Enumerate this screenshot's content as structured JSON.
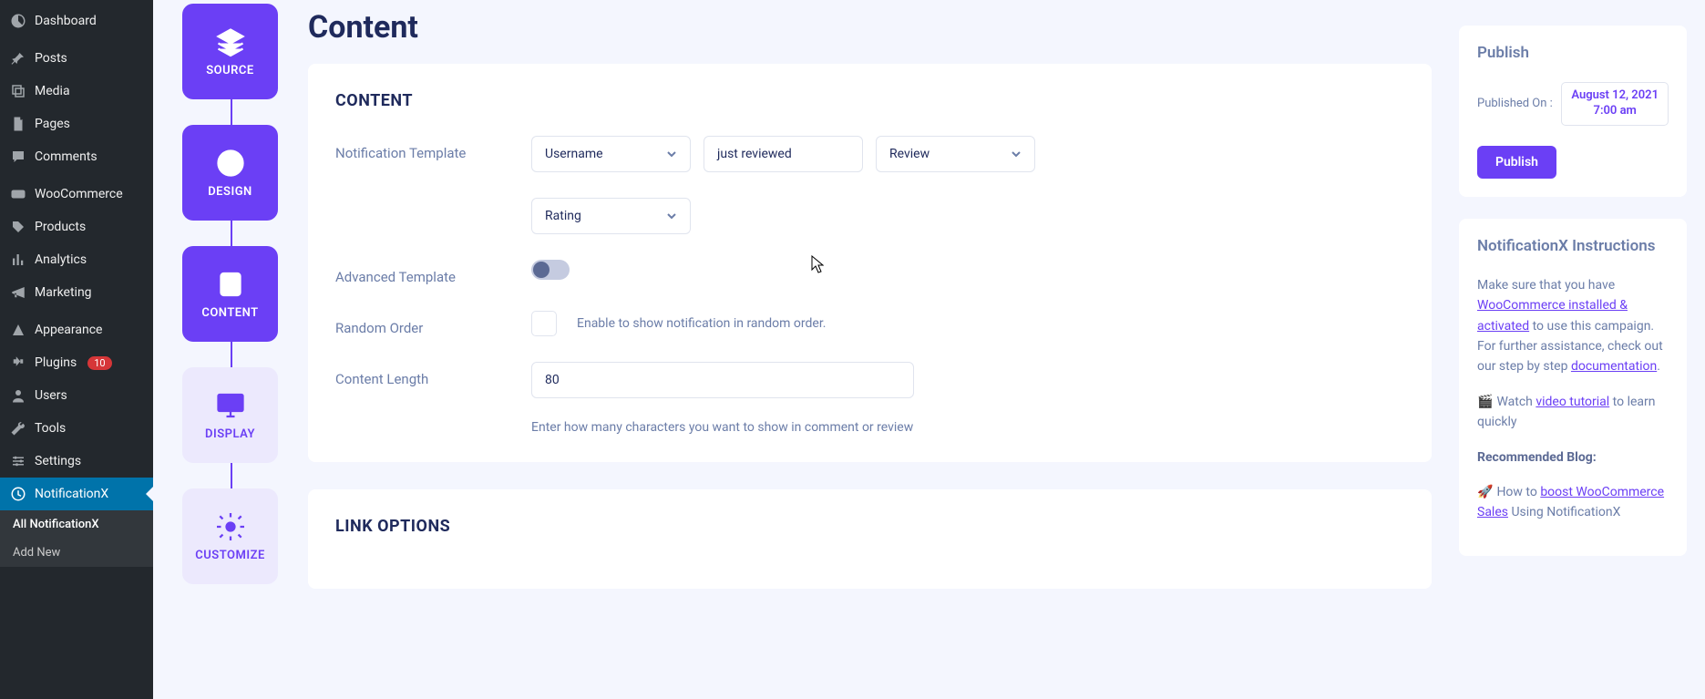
{
  "wp_sidebar": {
    "items": [
      {
        "label": "Dashboard",
        "icon": "dashboard"
      },
      {
        "label": "Posts",
        "icon": "pin"
      },
      {
        "label": "Media",
        "icon": "media"
      },
      {
        "label": "Pages",
        "icon": "pages"
      },
      {
        "label": "Comments",
        "icon": "comment"
      },
      {
        "label": "WooCommerce",
        "icon": "woo"
      },
      {
        "label": "Products",
        "icon": "products"
      },
      {
        "label": "Analytics",
        "icon": "analytics"
      },
      {
        "label": "Marketing",
        "icon": "marketing"
      },
      {
        "label": "Appearance",
        "icon": "appearance"
      },
      {
        "label": "Plugins",
        "icon": "plugins",
        "badge": "10"
      },
      {
        "label": "Users",
        "icon": "users"
      },
      {
        "label": "Tools",
        "icon": "tools"
      },
      {
        "label": "Settings",
        "icon": "settings"
      },
      {
        "label": "NotificationX",
        "icon": "notifx",
        "active": true
      }
    ],
    "subitems": [
      {
        "label": "All NotificationX",
        "current": true
      },
      {
        "label": "Add New"
      }
    ]
  },
  "steps": [
    {
      "label": "SOURCE",
      "icon": "layers"
    },
    {
      "label": "DESIGN",
      "icon": "palette"
    },
    {
      "label": "CONTENT",
      "icon": "doc"
    },
    {
      "label": "DISPLAY",
      "icon": "monitor"
    },
    {
      "label": "CUSTOMIZE",
      "icon": "gear"
    }
  ],
  "page": {
    "title": "Content"
  },
  "content_card": {
    "title": "CONTENT",
    "fields": {
      "template_label": "Notification Template",
      "dd_username": "Username",
      "txt_middle": "just reviewed",
      "dd_review": "Review",
      "dd_rating": "Rating",
      "adv_label": "Advanced Template",
      "random_label": "Random Order",
      "random_help": "Enable to show notification in random order.",
      "length_label": "Content Length",
      "length_value": "80",
      "length_hint": "Enter how many characters you want to show in comment or review"
    }
  },
  "link_card": {
    "title": "LINK OPTIONS"
  },
  "publish": {
    "title": "Publish",
    "on_label": "Published On :",
    "on_value_line1": "August 12, 2021",
    "on_value_line2": "7:00 am",
    "button": "Publish"
  },
  "instructions": {
    "title": "NotificationX Instructions",
    "p1_a": "Make sure that you have ",
    "p1_link": "WooCommerce installed & activated",
    "p1_b": " to use this campaign. For further assistance, check out our step by step ",
    "p1_doclink": "documentation",
    "p2_a": "Watch ",
    "p2_link": "video tutorial",
    "p2_b": " to learn quickly",
    "p3": "Recommended Blog:",
    "p4_a": "How to ",
    "p4_link": "boost WooCommerce Sales",
    "p4_b": " Using NotificationX"
  }
}
